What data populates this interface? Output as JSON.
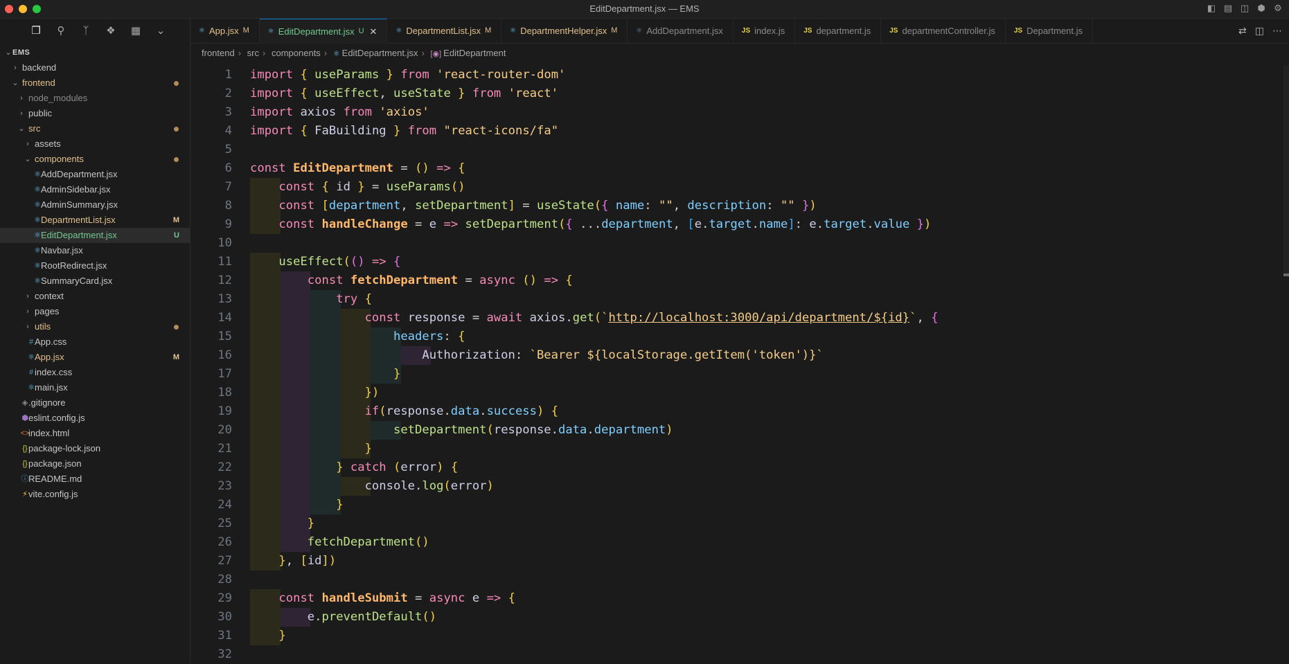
{
  "window": {
    "title": "EditDepartment.jsx — EMS",
    "controls": [
      "toggle-sidebar-icon",
      "toggle-panel-icon",
      "layout-icon",
      "extensions-icon",
      "settings-icon"
    ]
  },
  "explorer": {
    "section_title": "EMS",
    "activity_icons": [
      "files-icon",
      "search-icon",
      "source-control-icon",
      "extensions-icon",
      "layout-icon",
      "chevron-down-icon"
    ],
    "items": [
      {
        "label": "backend",
        "type": "folder",
        "open": false,
        "depth": 0,
        "status": ""
      },
      {
        "label": "frontend",
        "type": "folder",
        "open": true,
        "depth": 0,
        "status": "dot"
      },
      {
        "label": "node_modules",
        "type": "folder",
        "open": false,
        "depth": 1,
        "status": ""
      },
      {
        "label": "public",
        "type": "folder",
        "open": false,
        "depth": 1,
        "status": ""
      },
      {
        "label": "src",
        "type": "folder",
        "open": true,
        "depth": 1,
        "status": "dot"
      },
      {
        "label": "assets",
        "type": "folder",
        "open": false,
        "depth": 2,
        "status": ""
      },
      {
        "label": "components",
        "type": "folder",
        "open": true,
        "depth": 2,
        "status": "dot"
      },
      {
        "label": "AddDepartment.jsx",
        "type": "react",
        "depth": 3,
        "status": ""
      },
      {
        "label": "AdminSidebar.jsx",
        "type": "react",
        "depth": 3,
        "status": ""
      },
      {
        "label": "AdminSummary.jsx",
        "type": "react",
        "depth": 3,
        "status": ""
      },
      {
        "label": "DepartmentList.jsx",
        "type": "react",
        "depth": 3,
        "status": "M"
      },
      {
        "label": "EditDepartment.jsx",
        "type": "react",
        "depth": 3,
        "status": "U"
      },
      {
        "label": "Navbar.jsx",
        "type": "react",
        "depth": 3,
        "status": ""
      },
      {
        "label": "RootRedirect.jsx",
        "type": "react",
        "depth": 3,
        "status": ""
      },
      {
        "label": "SummaryCard.jsx",
        "type": "react",
        "depth": 3,
        "status": ""
      },
      {
        "label": "context",
        "type": "folder",
        "open": false,
        "depth": 2,
        "status": ""
      },
      {
        "label": "pages",
        "type": "folder",
        "open": false,
        "depth": 2,
        "status": ""
      },
      {
        "label": "utils",
        "type": "folder",
        "open": false,
        "depth": 2,
        "status": "dot"
      },
      {
        "label": "App.css",
        "type": "css",
        "depth": 2,
        "status": ""
      },
      {
        "label": "App.jsx",
        "type": "react",
        "depth": 2,
        "status": "M"
      },
      {
        "label": "index.css",
        "type": "css",
        "depth": 2,
        "status": ""
      },
      {
        "label": "main.jsx",
        "type": "react",
        "depth": 2,
        "status": ""
      },
      {
        "label": ".gitignore",
        "type": "git",
        "depth": 1,
        "status": ""
      },
      {
        "label": "eslint.config.js",
        "type": "eslint",
        "depth": 1,
        "status": ""
      },
      {
        "label": "index.html",
        "type": "html",
        "depth": 1,
        "status": ""
      },
      {
        "label": "package-lock.json",
        "type": "json",
        "depth": 1,
        "status": ""
      },
      {
        "label": "package.json",
        "type": "json",
        "depth": 1,
        "status": ""
      },
      {
        "label": "README.md",
        "type": "info",
        "depth": 1,
        "status": ""
      },
      {
        "label": "vite.config.js",
        "type": "vite",
        "depth": 1,
        "status": ""
      }
    ]
  },
  "tabs": [
    {
      "label": "App.jsx",
      "icon": "react",
      "mark": "M",
      "active": false,
      "dim": false
    },
    {
      "label": "EditDepartment.jsx",
      "icon": "react",
      "mark": "U",
      "active": true,
      "dim": false
    },
    {
      "label": "DepartmentList.jsx",
      "icon": "react",
      "mark": "M",
      "active": false,
      "dim": false
    },
    {
      "label": "DepartmentHelper.jsx",
      "icon": "react",
      "mark": "M",
      "active": false,
      "dim": false
    },
    {
      "label": "AddDepartment.jsx",
      "icon": "react",
      "mark": "",
      "active": false,
      "dim": true
    },
    {
      "label": "index.js",
      "icon": "js",
      "mark": "",
      "active": false,
      "dim": true
    },
    {
      "label": "department.js",
      "icon": "js",
      "mark": "",
      "active": false,
      "dim": true
    },
    {
      "label": "departmentController.js",
      "icon": "js",
      "mark": "",
      "active": false,
      "dim": true
    },
    {
      "label": "Department.js",
      "icon": "js",
      "mark": "",
      "active": false,
      "dim": true
    }
  ],
  "breadcrumb": [
    "frontend",
    "src",
    "components",
    "EditDepartment.jsx",
    "EditDepartment"
  ],
  "code_lines": [
    "import { useParams } from 'react-router-dom'",
    "import { useEffect, useState } from 'react'",
    "import axios from 'axios'",
    "import { FaBuilding } from \"react-icons/fa\"",
    "",
    "const EditDepartment = () => {",
    "    const { id } = useParams()",
    "    const [department, setDepartment] = useState({ name: \"\", description: \"\" })",
    "    const handleChange = e => setDepartment({ ...department, [e.target.name]: e.target.value })",
    "",
    "    useEffect(() => {",
    "        const fetchDepartment = async () => {",
    "            try {",
    "                const response = await axios.get(`http://localhost:3000/api/department/${id}`, {",
    "                    headers: {",
    "                        Authorization: `Bearer ${localStorage.getItem('token')}`",
    "                    }",
    "                })",
    "                if(response.data.success) {",
    "                    setDepartment(response.data.department)",
    "                }",
    "            } catch (error) {",
    "                console.log(error)",
    "            }",
    "        }",
    "        fetchDepartment()",
    "    }, [id])",
    "",
    "    const handleSubmit = async e => {",
    "        e.preventDefault()",
    "    }",
    ""
  ],
  "colors": {
    "accent": "#0078d4",
    "modified": "#e2c08d",
    "untracked": "#73c991"
  }
}
